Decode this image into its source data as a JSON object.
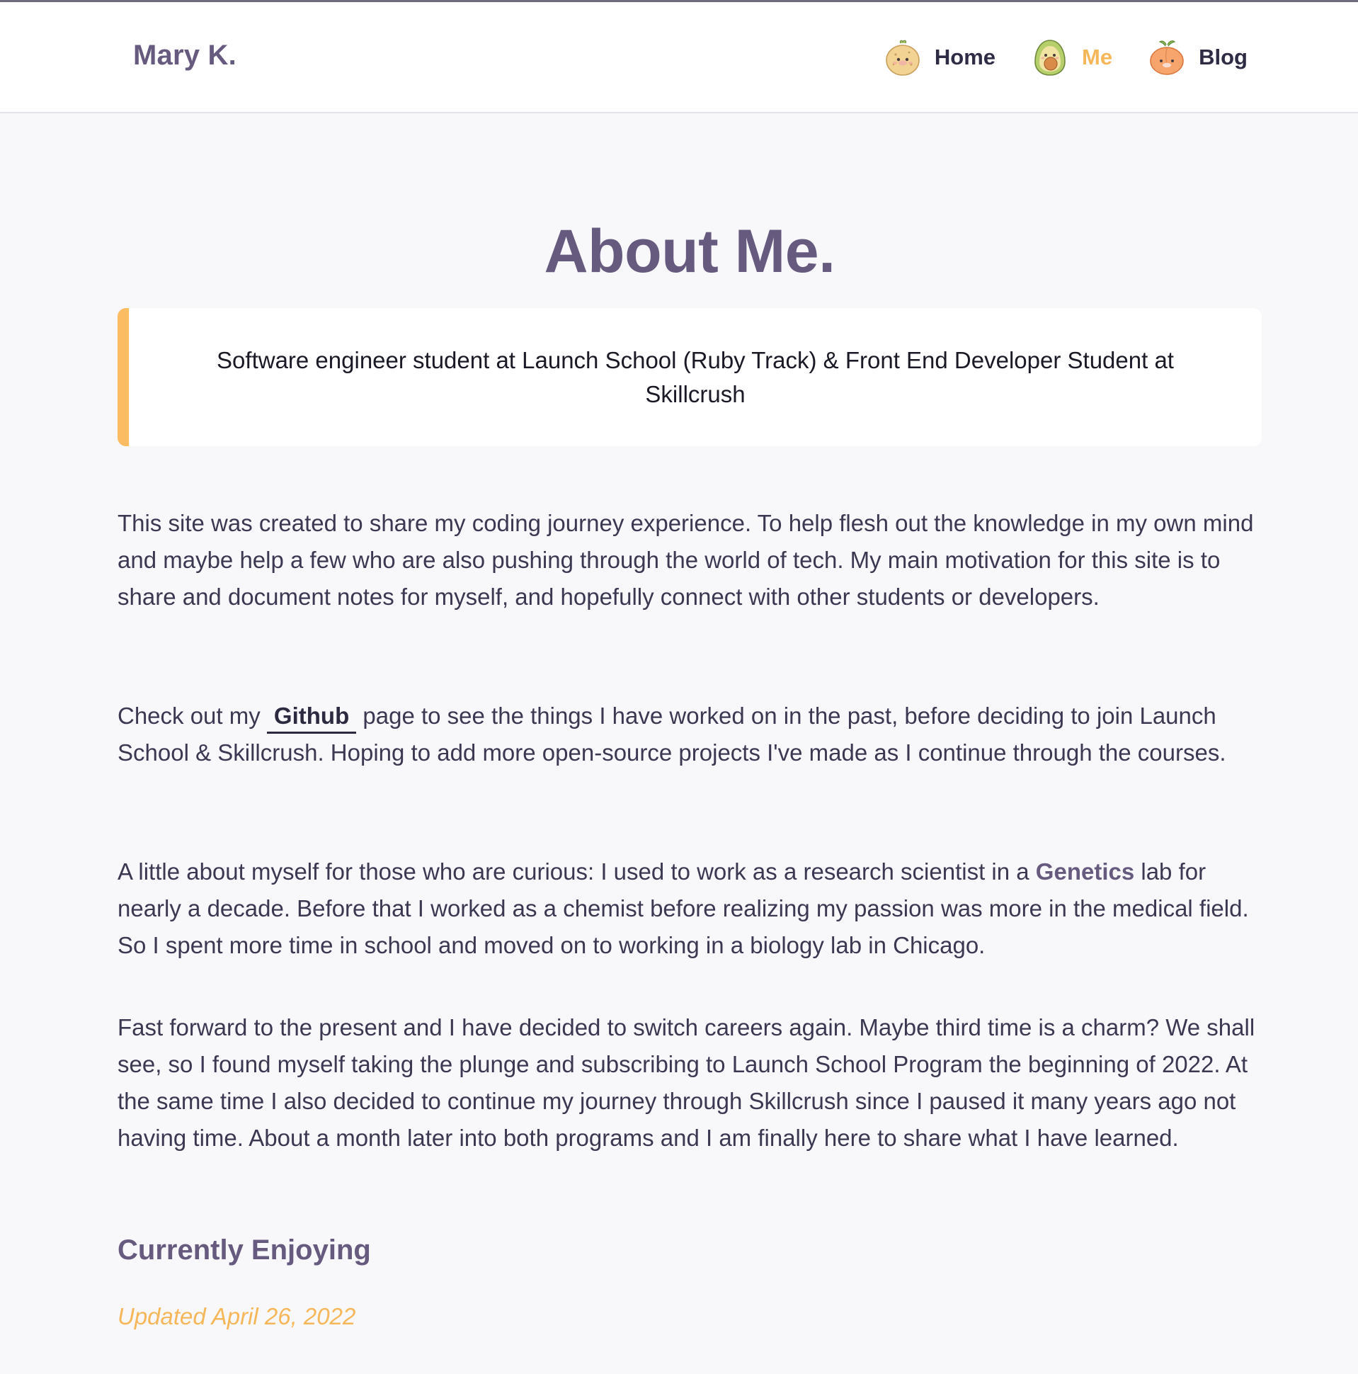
{
  "header": {
    "brand": "Mary K.",
    "nav": [
      {
        "label": "Home",
        "icon": "potato-mascot-icon",
        "active": false
      },
      {
        "label": "Me",
        "icon": "avocado-mascot-icon",
        "active": true
      },
      {
        "label": "Blog",
        "icon": "peach-mascot-icon",
        "active": false
      }
    ]
  },
  "main": {
    "title": "About Me.",
    "tagline": "Software engineer student at Launch School (Ruby Track) & Front End Developer Student at Skillcrush",
    "paragraphs": {
      "p1": "This site was created to share my coding journey experience. To help flesh out the knowledge in my own mind and maybe help a few who are also pushing through the world of tech. My main motivation for this site is to share and document notes for myself, and hopefully connect with other students or developers.",
      "p2_before": "Check out my",
      "p2_link": "Github",
      "p2_after": "page to see the things I have worked on in the past, before deciding to join Launch School & Skillcrush. Hoping to add more open-source projects I've made as I continue through the courses.",
      "p3_before": "A little about myself for those who are curious: I used to work as a research scientist in a",
      "p3_emph": "Genetics",
      "p3_after": "lab for nearly a decade. Before that I worked as a chemist before realizing my passion was more in the medical field. So I spent more time in school and moved on to working in a biology lab in Chicago.",
      "p4": "Fast forward to the present and I have decided to switch careers again. Maybe third time is a charm? We shall see, so I found myself taking the plunge and subscribing to Launch School Program the beginning of 2022. At the same time I also decided to continue my journey through Skillcrush since I paused it many years ago not having time. About a month later into both programs and I am finally here to share what I have learned."
    },
    "section_title": "Currently Enjoying",
    "updated": "Updated April 26, 2022"
  },
  "colors": {
    "brand_purple": "#665a7e",
    "accent_orange": "#f5b75a",
    "tagline_border": "#fcbc62",
    "background": "#f8f8fb"
  }
}
